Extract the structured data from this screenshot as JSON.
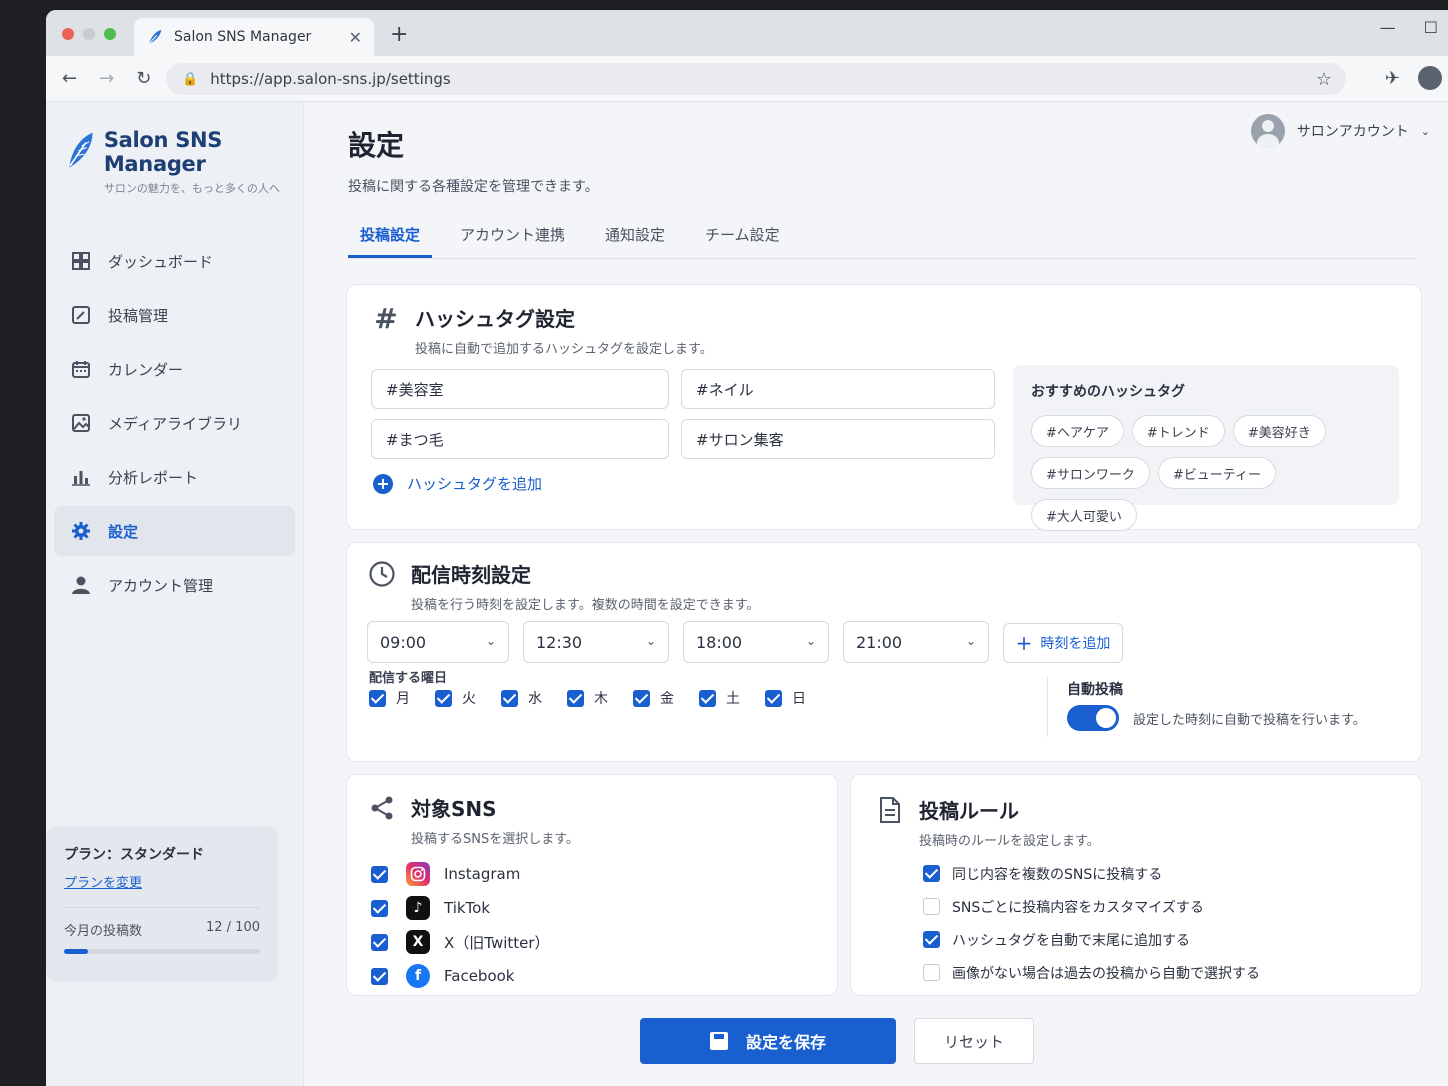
{
  "browser": {
    "tab_title": "Salon SNS Manager",
    "url": "https://app.salon-sns.jp/settings"
  },
  "brand": {
    "name": "Salon SNS Manager",
    "tagline": "サロンの魅力を、もっと多くの人へ"
  },
  "sidebar": {
    "items": [
      {
        "label": "ダッシュボード",
        "icon": "dashboard-icon"
      },
      {
        "label": "投稿管理",
        "icon": "post-edit-icon"
      },
      {
        "label": "カレンダー",
        "icon": "calendar-icon"
      },
      {
        "label": "メディアライブラリ",
        "icon": "image-icon"
      },
      {
        "label": "分析レポート",
        "icon": "bar-chart-icon"
      },
      {
        "label": "設定",
        "icon": "gear-icon",
        "active": true
      },
      {
        "label": "アカウント管理",
        "icon": "user-icon"
      }
    ],
    "plan": {
      "label": "プラン：スタンダード",
      "change_link": "プランを変更",
      "posts_label": "今月の投稿数",
      "posts_count": "12 / 100",
      "posts_used": 12,
      "posts_limit": 100
    }
  },
  "header": {
    "account_name": "サロンアカウント",
    "title": "設定",
    "subtitle": "投稿に関する各種設定を管理できます。"
  },
  "tabs": [
    "投稿設定",
    "アカウント連携",
    "通知設定",
    "チーム設定"
  ],
  "hashtag": {
    "title": "ハッシュタグ設定",
    "desc": "投稿に自動で追加するハッシュタグを設定します。",
    "tags": [
      "#美容室",
      "#ネイル",
      "#まつ毛",
      "#サロン集客"
    ],
    "add_label": "ハッシュタグを追加",
    "recommended_title": "おすすめのハッシュタグ",
    "recommended": [
      "#ヘアケア",
      "#トレンド",
      "#美容好き",
      "#サロンワーク",
      "#ビューティー",
      "#大人可愛い"
    ]
  },
  "schedule": {
    "title": "配信時刻設定",
    "desc": "投稿を行う時刻を設定します。複数の時間を設定できます。",
    "times": [
      "09:00",
      "12:30",
      "18:00",
      "21:00"
    ],
    "add_time_label": "時刻を追加",
    "days_label": "配信する曜日",
    "days": [
      "月",
      "火",
      "水",
      "木",
      "金",
      "土",
      "日"
    ],
    "auto_post_label": "自動投稿",
    "auto_post_desc": "設定した時刻に自動で投稿を行います。",
    "auto_post_on": true
  },
  "sns": {
    "title": "対象SNS",
    "desc": "投稿するSNSを選択します。",
    "items": [
      {
        "label": "Instagram",
        "checked": true,
        "icon": "instagram-icon"
      },
      {
        "label": "TikTok",
        "checked": true,
        "icon": "tiktok-icon"
      },
      {
        "label": "X（旧Twitter）",
        "checked": true,
        "icon": "x-icon"
      },
      {
        "label": "Facebook",
        "checked": true,
        "icon": "facebook-icon"
      }
    ]
  },
  "rules": {
    "title": "投稿ルール",
    "desc": "投稿時のルールを設定します。",
    "items": [
      {
        "label": "同じ内容を複数のSNSに投稿する",
        "checked": true
      },
      {
        "label": "SNSごとに投稿内容をカスタマイズする",
        "checked": false
      },
      {
        "label": "ハッシュタグを自動で末尾に追加する",
        "checked": true
      },
      {
        "label": "画像がない場合は過去の投稿から自動で選択する",
        "checked": false
      }
    ]
  },
  "actions": {
    "save": "設定を保存",
    "reset": "リセット"
  },
  "colors": {
    "accent": "#1a5fcf",
    "brand_text": "#1d3f73"
  }
}
